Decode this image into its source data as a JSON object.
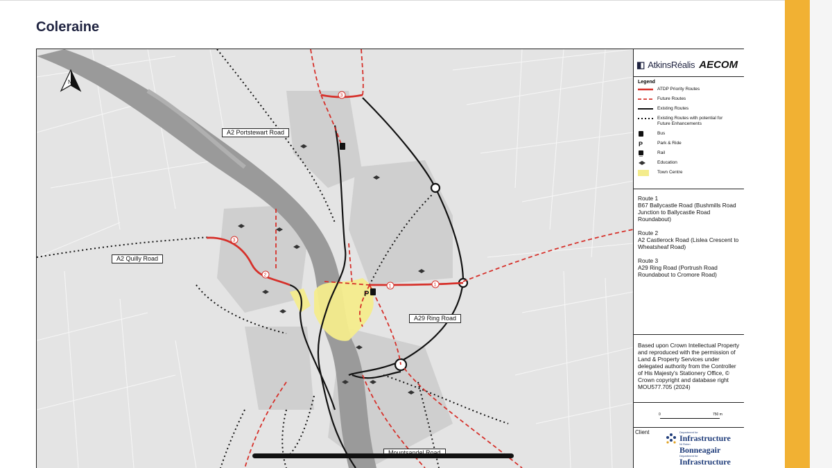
{
  "page": {
    "title": "Coleraine"
  },
  "map": {
    "road_labels": {
      "portstewart": "A2 Portstewart Road",
      "quilly": "A2 Quilly Road",
      "ring": "A29 Ring Road",
      "mountsandel": "Mountsandel Road"
    },
    "route_markers": [
      "3",
      "3",
      "2",
      "1",
      "1"
    ],
    "north_label": "N"
  },
  "panel": {
    "logo": {
      "atkins": "AtkinsRéalis",
      "aecom": "AECOM"
    },
    "legend": {
      "title": "Legend",
      "items": [
        {
          "label": "ATDP Priority Routes",
          "symbol": "red-solid-line"
        },
        {
          "label": "Future Routes",
          "symbol": "red-dashed-line"
        },
        {
          "label": "Existing Routes",
          "symbol": "black-solid-line"
        },
        {
          "label": "Existing Routes with potential for Future Enhancements",
          "symbol": "black-dotted-line"
        },
        {
          "label": "Bus",
          "symbol": "bus-icon"
        },
        {
          "label": "Park & Ride",
          "symbol": "park-ride-icon"
        },
        {
          "label": "Rail",
          "symbol": "rail-icon"
        },
        {
          "label": "Education",
          "symbol": "education-icon"
        },
        {
          "label": "Town Centre",
          "symbol": "town-centre-swatch"
        }
      ]
    },
    "routes": [
      {
        "name": "Route 1",
        "desc": "B67 Ballycastle Road (Bushmills Road Junction to Ballycastle Road Roundabout)"
      },
      {
        "name": "Route 2",
        "desc": "A2 Castlerock Road (Lislea Crescent to Wheatsheaf Road)"
      },
      {
        "name": "Route 3",
        "desc": "A29 Ring Road (Portrush Road Roundabout to Cromore Road)"
      }
    ],
    "copyright": "Based upon Crown Intellectual Property and reproduced with the permission of Land & Property Services under delegated authority from the Controller of His Majesty's Stationery Office, © Crown copyright and database right MOU577.705 (2024)",
    "scale": {
      "start": "0",
      "end": "750 m"
    },
    "client": {
      "label": "Client",
      "dept1_small": "Department for",
      "dept1": "Infrastructure",
      "dept2_small": "Ní Roinn",
      "dept2": "Bonneagair",
      "dept3_small": "Department for",
      "dept3": "Infrastructure"
    }
  },
  "colors": {
    "priority_route": "#d6302a",
    "existing_route": "#111111",
    "town_centre": "#f4ec8c",
    "accent_bar": "#f1b133",
    "title": "#1f2340"
  }
}
